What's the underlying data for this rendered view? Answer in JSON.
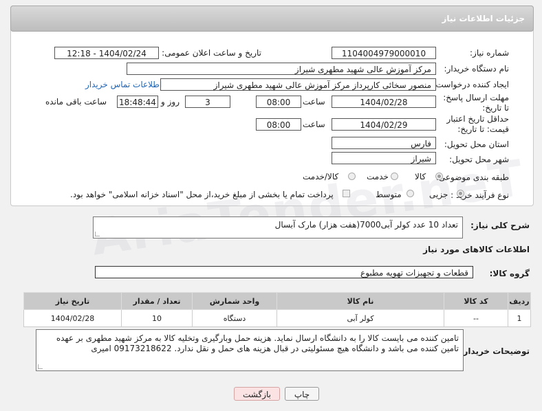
{
  "header": {
    "title": "جزئیات اطلاعات نیاز"
  },
  "labels": {
    "need_number": "شماره نیاز:",
    "announce_datetime": "تاریخ و ساعت اعلان عمومی:",
    "buyer_org": "نام دستگاه خریدار:",
    "requester": "ایجاد کننده درخواست:",
    "contact_link": "اطلاعات تماس خریدار",
    "reply_deadline": "مهلت ارسال پاسخ: تا تاریخ:",
    "time_word": "ساعت",
    "day_word": "روز و",
    "remaining": "ساعت باقی مانده",
    "price_validity": "حداقل تاریخ اعتبار قیمت: تا تاریخ:",
    "province": "استان محل تحویل:",
    "city": "شهر محل تحویل:",
    "category": "طبقه بندی موضوعی:",
    "process_type": "نوع فرآیند خرید :",
    "payment_note": "پرداخت تمام یا بخشی از مبلغ خرید،از محل \"اسناد خزانه اسلامی\" خواهد بود.",
    "general_desc": "شرح کلی نیاز:",
    "goods_info": "اطلاعات کالاهای مورد نیاز",
    "goods_group": "گروه کالا:",
    "buyer_notes": "توضیحات خریدار:"
  },
  "values": {
    "need_number": "1104004979000010",
    "announce_datetime": "1404/02/24 - 12:18",
    "buyer_org": "مرکز آموزش عالی شهید مطهری شیراز",
    "requester": "منصور سخائی کارپرداز مرکز آموزش عالی شهید مطهری شیراز",
    "reply_date": "1404/02/28",
    "reply_time": "08:00",
    "reply_days": "3",
    "reply_remaining": "18:48:44",
    "validity_date": "1404/02/29",
    "validity_time": "08:00",
    "province": "فارس",
    "city": "شیراز",
    "general_desc": "تعداد 10 عدد کولر آبی7000(هفت هزار) مارک آبسال",
    "goods_group": "قطعات و تجهیزات تهویه مطبوع",
    "buyer_notes": "تامین کننده می بایست کالا را به دانشگاه ارسال نماید. هزینه حمل وبارگیری وتخلیه کالا به مرکز شهید مطهری بر عهده تامین کننده می باشد و دانشگاه هیچ مسئولیتی در قبال هزینه های حمل و نقل ندارد. 09173218622 امیری"
  },
  "category_options": {
    "goods": "کالا",
    "service": "خدمت",
    "goods_service": "کالا/خدمت",
    "selected": "goods"
  },
  "process_options": {
    "minor": "جزیی",
    "medium": "متوسط",
    "selected": "minor"
  },
  "table": {
    "headers": [
      "ردیف",
      "کد کالا",
      "نام کالا",
      "واحد شمارش",
      "تعداد / مقدار",
      "تاریخ نیاز"
    ],
    "rows": [
      [
        "1",
        "--",
        "کولر آبی",
        "دستگاه",
        "10",
        "1404/02/28"
      ]
    ]
  },
  "buttons": {
    "print": "چاپ",
    "back": "بازگشت"
  },
  "watermark": "AriaTender.neT"
}
